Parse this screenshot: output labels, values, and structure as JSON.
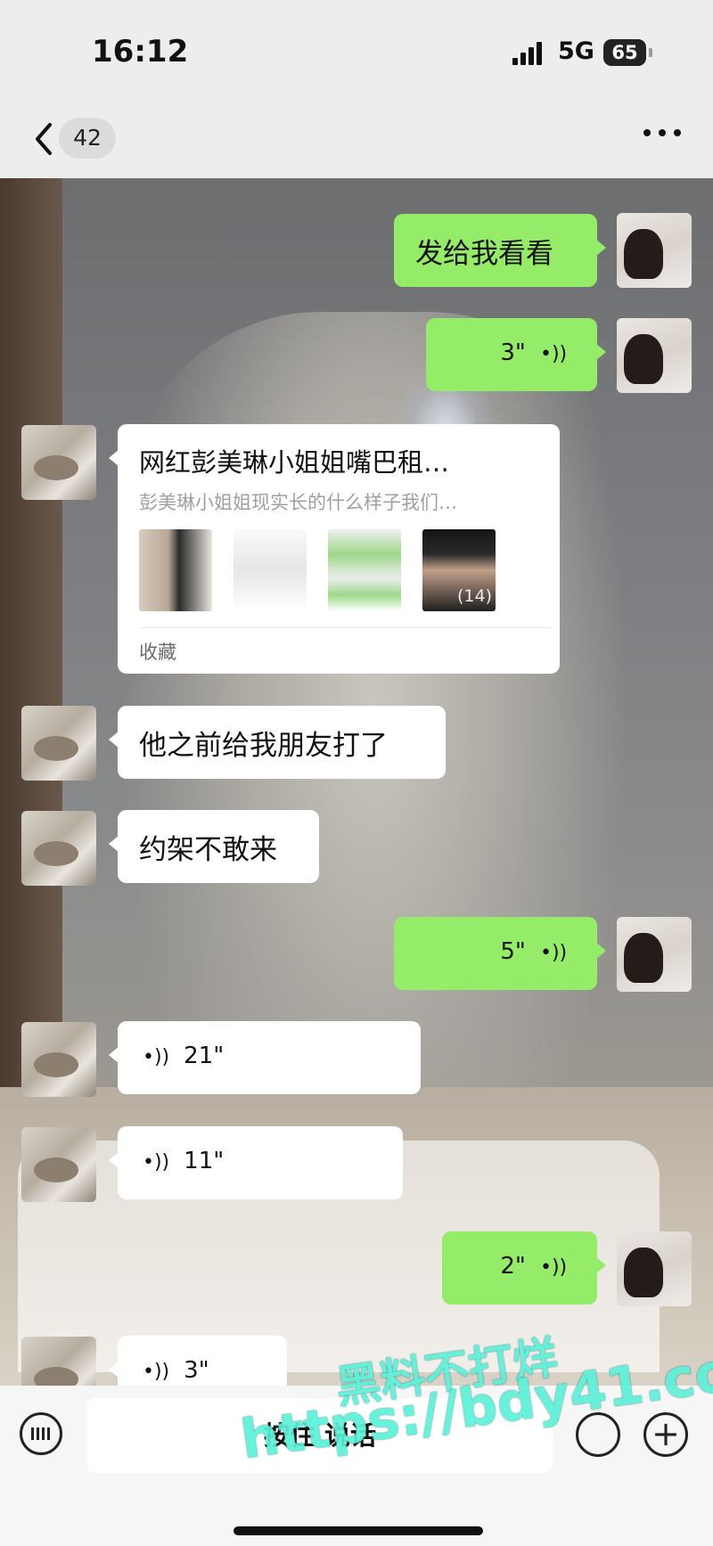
{
  "status_bar": {
    "time": "16:12",
    "network": "5G",
    "battery": "65"
  },
  "nav": {
    "unread_count": "42"
  },
  "messages": [
    {
      "side": "out",
      "type": "text",
      "text": "发给我看看"
    },
    {
      "side": "out",
      "type": "voice",
      "duration": "3\""
    },
    {
      "side": "in",
      "type": "card",
      "title": "网红彭美琳小姐姐嘴巴租…",
      "description": "彭美琳小姐姐现实长的什么样子我们…",
      "image_count": "(14)",
      "source": "收藏"
    },
    {
      "side": "in",
      "type": "text",
      "text": "他之前给我朋友打了"
    },
    {
      "side": "in",
      "type": "text",
      "text": "约架不敢来"
    },
    {
      "side": "out",
      "type": "voice",
      "duration": "5\""
    },
    {
      "side": "in",
      "type": "voice",
      "duration": "21\""
    },
    {
      "side": "in",
      "type": "voice",
      "duration": "11\""
    },
    {
      "side": "out",
      "type": "voice",
      "duration": "2\""
    },
    {
      "side": "in",
      "type": "voice",
      "duration": "3\""
    }
  ],
  "input_bar": {
    "hold_to_talk": "按住 说话"
  },
  "watermark": {
    "line1": "黑料不打烊",
    "line2": "https://bdy41.co"
  },
  "colors": {
    "outgoing_bubble": "#95ec69",
    "incoming_bubble": "#ffffff",
    "background": "#ededed"
  }
}
